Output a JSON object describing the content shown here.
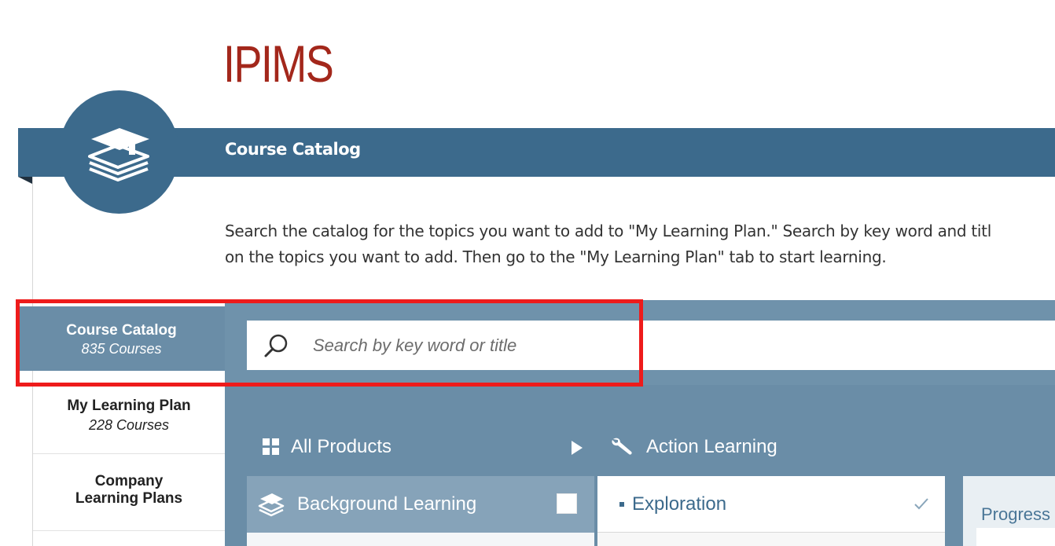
{
  "brand": {
    "logo_text": "IPIMS",
    "logo_color": "#a3271b"
  },
  "header": {
    "title": "Course Catalog",
    "bar_color": "#3c6a8c",
    "icon": "stacked-books-icon"
  },
  "intro": {
    "line1": "Search the catalog for the topics you want to add to \"My Learning Plan.\" Search by key word and titl",
    "line2": "on the topics you want to add. Then go to the \"My Learning Plan\" tab to start learning."
  },
  "side_tabs": [
    {
      "label": "Course Catalog",
      "count": "835 Courses",
      "active": true
    },
    {
      "label": "My Learning Plan",
      "count": "228 Courses",
      "active": false
    },
    {
      "label_line1": "Company",
      "label_line2": "Learning Plans",
      "active": false
    }
  ],
  "search": {
    "placeholder": "Search by key word or title",
    "value": "",
    "icon": "search-icon"
  },
  "filters": {
    "all_products": {
      "label": "All Products",
      "icon": "grid-icon"
    },
    "expand_icon": "play-arrow-icon",
    "action_learning": {
      "label": "Action Learning",
      "icon": "wrench-icon"
    }
  },
  "columns": {
    "left": {
      "item_label": "Background Learning",
      "icon": "layers-icon",
      "checked": false
    },
    "middle": {
      "item_label": "Exploration",
      "icon": "checkmark-icon"
    },
    "right": {
      "label": "Progress R"
    }
  },
  "colors": {
    "panel": "#6a8da7",
    "highlight": "#ee1b1b"
  }
}
